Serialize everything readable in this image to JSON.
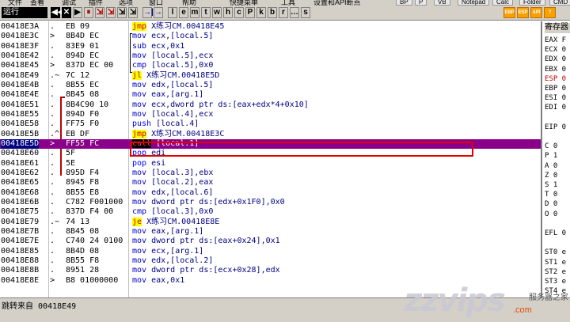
{
  "menu": [
    "文件",
    "查看",
    "调试",
    "插件",
    "选项",
    "窗口",
    "帮助",
    "快捷菜单",
    "工具",
    "设置和API断点"
  ],
  "menu_right": [
    "BP",
    "P",
    "VB",
    "Notepad",
    "Calc",
    "Folder",
    "CMD"
  ],
  "toolbar": {
    "status_label": "运行",
    "buttons": [
      "◀◀",
      "✕",
      "▶",
      "⏸",
      "⇲",
      "⇲",
      "⇲",
      "⇲",
      "→|",
      "→",
      "l",
      "e",
      "m",
      "t",
      "w",
      "h",
      "c",
      "P",
      "k",
      "b",
      "r",
      "…",
      "s"
    ],
    "right_buttons": [
      "EBP",
      "ESP",
      "API",
      "?"
    ]
  },
  "disasm": [
    {
      "addr": "00418E3A",
      "mark": ".",
      "hex": "EB 09",
      "op": "jmp",
      "kind": "jmp",
      "args": "X练习CM.00418E45"
    },
    {
      "addr": "00418E3C",
      "mark": ">",
      "hex": "8B4D EC",
      "op": "mov",
      "kind": "mov",
      "args": "ecx,[local.5]"
    },
    {
      "addr": "00418E3F",
      "mark": ".",
      "hex": "83E9 01",
      "op": "sub",
      "kind": "sub",
      "args": "ecx,0x1"
    },
    {
      "addr": "00418E42",
      "mark": ".",
      "hex": "894D EC",
      "op": "mov",
      "kind": "mov",
      "args": "[local.5],ecx"
    },
    {
      "addr": "00418E45",
      "mark": ">",
      "hex": "837D EC 00",
      "op": "cmp",
      "kind": "cmp",
      "args": "[local.5],0x0"
    },
    {
      "addr": "00418E49",
      "mark": ".~",
      "hex": "7C 12",
      "op": "jl",
      "kind": "jcc",
      "args": "X练习CM.00418E5D"
    },
    {
      "addr": "00418E4B",
      "mark": ".",
      "hex": "8B55 EC",
      "op": "mov",
      "kind": "mov",
      "args": "edx,[local.5]"
    },
    {
      "addr": "00418E4E",
      "mark": ".",
      "hex": "8B45 08",
      "op": "mov",
      "kind": "mov",
      "args": "eax,[arg.1]"
    },
    {
      "addr": "00418E51",
      "mark": ".",
      "hex": "8B4C90 10",
      "op": "mov",
      "kind": "mov",
      "args": "ecx,dword ptr ds:[eax+edx*4+0x10]"
    },
    {
      "addr": "00418E55",
      "mark": ".",
      "hex": "894D F0",
      "op": "mov",
      "kind": "mov",
      "args": "[local.4],ecx"
    },
    {
      "addr": "00418E58",
      "mark": ".",
      "hex": "FF75 F0",
      "op": "push",
      "kind": "push",
      "args": "[local.4]"
    },
    {
      "addr": "00418E5B",
      "mark": ".^",
      "hex": "EB DF",
      "op": "jmp",
      "kind": "jmp",
      "args": "X练习CM.00418E3C"
    },
    {
      "addr": "00418E5D",
      "mark": ">",
      "hex": "FF55 FC",
      "op": "call",
      "kind": "call",
      "args": "[local.1]",
      "selected": true
    },
    {
      "addr": "00418E60",
      "mark": ".",
      "hex": "5F",
      "op": "pop",
      "kind": "pop",
      "args": "edi"
    },
    {
      "addr": "00418E61",
      "mark": ".",
      "hex": "5E",
      "op": "pop",
      "kind": "pop",
      "args": "esi"
    },
    {
      "addr": "00418E62",
      "mark": ".",
      "hex": "895D F4",
      "op": "mov",
      "kind": "mov",
      "args": "[local.3],ebx"
    },
    {
      "addr": "00418E65",
      "mark": ".",
      "hex": "8945 F8",
      "op": "mov",
      "kind": "mov",
      "args": "[local.2],eax"
    },
    {
      "addr": "00418E68",
      "mark": ".",
      "hex": "8B55 E8",
      "op": "mov",
      "kind": "mov",
      "args": "edx,[local.6]"
    },
    {
      "addr": "00418E6B",
      "mark": ".",
      "hex": "C782 F001000",
      "op": "mov",
      "kind": "mov",
      "args": "dword ptr ds:[edx+0x1F0],0x0"
    },
    {
      "addr": "00418E75",
      "mark": ".",
      "hex": "837D F4 00",
      "op": "cmp",
      "kind": "cmp",
      "args": "[local.3],0x0"
    },
    {
      "addr": "00418E79",
      "mark": ".~",
      "hex": "74 13",
      "op": "je",
      "kind": "jcc",
      "args": "X练习CM.00418E8E"
    },
    {
      "addr": "00418E7B",
      "mark": ".",
      "hex": "8B45 08",
      "op": "mov",
      "kind": "mov",
      "args": "eax,[arg.1]"
    },
    {
      "addr": "00418E7E",
      "mark": ".",
      "hex": "C740 24 0100",
      "op": "mov",
      "kind": "mov",
      "args": "dword ptr ds:[eax+0x24],0x1"
    },
    {
      "addr": "00418E85",
      "mark": ".",
      "hex": "8B4D 08",
      "op": "mov",
      "kind": "mov",
      "args": "ecx,[arg.1]"
    },
    {
      "addr": "00418E88",
      "mark": ".",
      "hex": "8B55 F8",
      "op": "mov",
      "kind": "mov",
      "args": "edx,[local.2]"
    },
    {
      "addr": "00418E8B",
      "mark": ".",
      "hex": "8951 28",
      "op": "mov",
      "kind": "mov",
      "args": "dword ptr ds:[ecx+0x28],edx"
    },
    {
      "addr": "00418E8E",
      "mark": ">",
      "hex": "B8 01000000",
      "op": "mov",
      "kind": "mov",
      "args": "eax,0x1"
    }
  ],
  "registers": {
    "title": "寄存器",
    "names": [
      "EAX F",
      "ECX 0",
      "EDX 0",
      "EBX 0",
      "ESP 0",
      "EBP 0",
      "ESI 0",
      "EDI 0",
      "",
      "EIP 0",
      "",
      "C 0",
      "P 1",
      "A 0",
      "Z 0",
      "S 1",
      "T 0",
      "D 0",
      "O 0",
      "",
      "EFL 0",
      "",
      "ST0 e",
      "ST1 e",
      "ST2 e",
      "ST3 e",
      "ST4 e"
    ]
  },
  "status": "跳转来自 00418E49",
  "watermark": {
    "logo": "zzvips",
    "tag": "服务器之家",
    "site": ".com"
  }
}
